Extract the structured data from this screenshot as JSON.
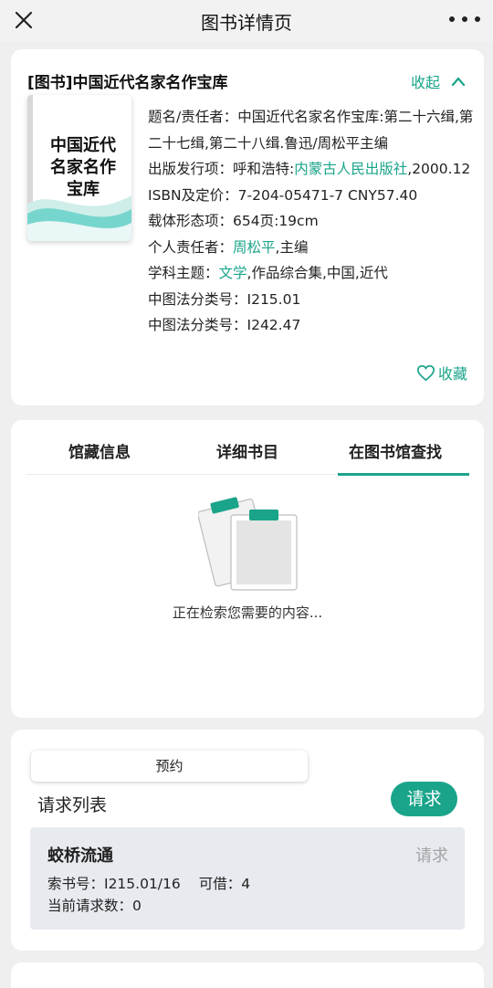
{
  "header": {
    "title": "图书详情页",
    "close_icon": "close-icon",
    "more_icon": "more-dots-icon"
  },
  "book": {
    "title": "[图书]中国近代名家名作宝库",
    "collapse_label": "收起",
    "cover_text": "中国近代名家名作宝库",
    "meta": {
      "title_resp_label": "题名/责任者：",
      "title_resp_value": "中国近代名家名作宝库:第二十六缉,第二十七缉,第二十八缉.鲁迅/周松平主编",
      "publish_label": "出版发行项：",
      "publish_place": "呼和浩特:",
      "publisher": "内蒙古人民出版社",
      "publish_date": ",2000.12",
      "isbn_label": "ISBN及定价：",
      "isbn_value": "7-204-05471-7 CNY57.40",
      "carrier_label": "载体形态项：",
      "carrier_value": "654页:19cm",
      "person_label": "个人责任者：",
      "person_link": "周松平",
      "person_suffix": ",主编",
      "subject_label": "学科主题：",
      "subject_link": "文学",
      "subject_suffix": ",作品综合集,中国,近代",
      "clc1_label": "中图法分类号：",
      "clc1_value": "I215.01",
      "clc2_label": "中图法分类号：",
      "clc2_value": "I242.47"
    },
    "favorite_label": "收藏"
  },
  "tabs": {
    "items": [
      {
        "label": "馆藏信息"
      },
      {
        "label": "详细书目"
      },
      {
        "label": "在图书馆查找"
      }
    ],
    "active_index": 2,
    "loading_text": "正在检索您需要的内容..."
  },
  "request": {
    "reserve_label": "预约",
    "list_label": "请求列表",
    "request_button": "请求",
    "library": {
      "name": "蛟桥流通",
      "request_link": "请求",
      "call_no": "索书号：I215.01/16",
      "available": "可借：4",
      "current_requests": "当前请求数：0"
    }
  },
  "colors": {
    "accent": "#1aa48a",
    "background": "#efefef",
    "item_bg": "#e7eaef"
  }
}
